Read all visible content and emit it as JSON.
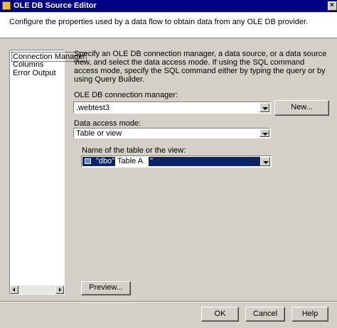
{
  "window": {
    "title": "OLE DB Source Editor"
  },
  "header": {
    "description": "Configure the properties used by a data flow to obtain data from any OLE DB provider."
  },
  "nav": {
    "items": [
      {
        "label": "Connection Manager",
        "selected": true
      },
      {
        "label": "Columns",
        "selected": false
      },
      {
        "label": "Error Output",
        "selected": false
      }
    ]
  },
  "main": {
    "description": "Specify an OLE DB connection manager, a data source, or a data source view, and select the data access mode. If using the SQL command access mode, specify the SQL command either by typing the query or by using Query Builder.",
    "connection_manager": {
      "label": "OLE DB connection manager:",
      "value": ".webtest3"
    },
    "new_button": "New...",
    "access_mode": {
      "label": "Data access mode:",
      "value": "Table or view"
    },
    "table": {
      "label": "Name of the table or the view:",
      "prefix": "\"dbo\".\"",
      "name": "Table A",
      "suffix": "\""
    },
    "preview_button": "Preview..."
  },
  "footer": {
    "ok": "OK",
    "cancel": "Cancel",
    "help": "Help"
  },
  "colors": {
    "titlebar": "#000080",
    "selection": "#0a246a",
    "dialog_face": "#d4d0c8"
  },
  "icons": [
    "window-icon",
    "close-icon",
    "dropdown-arrow-icon",
    "table-icon",
    "scroll-left-icon",
    "scroll-right-icon"
  ]
}
